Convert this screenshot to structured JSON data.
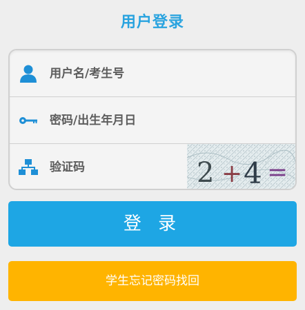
{
  "page": {
    "title": "用户登录"
  },
  "form": {
    "username": {
      "placeholder": "用户名/考生号",
      "value": "",
      "icon": "user-icon"
    },
    "password": {
      "placeholder": "密码/出生年月日",
      "value": "",
      "icon": "key-icon"
    },
    "captcha": {
      "placeholder": "验证码",
      "value": "",
      "icon": "sitemap-icon",
      "image_text": "2+4="
    }
  },
  "buttons": {
    "login_label": "登 录",
    "forgot_label": "学生忘记密码找回"
  },
  "colors": {
    "accent": "#29a3df",
    "login_button": "#1ea6e4",
    "forgot_button": "#ffb400",
    "background": "#eeeeee"
  }
}
